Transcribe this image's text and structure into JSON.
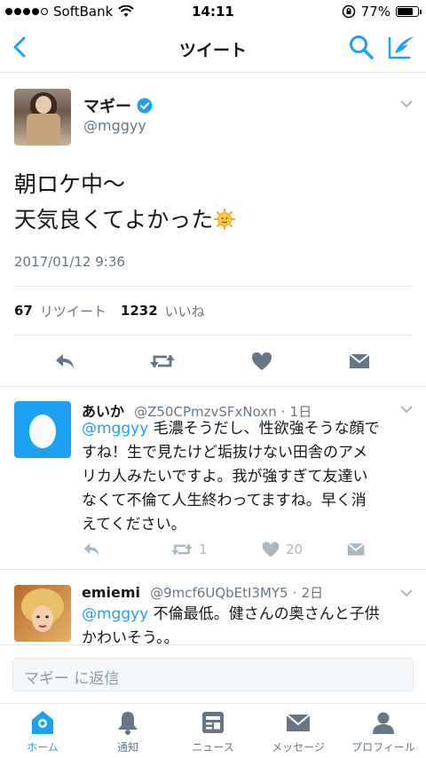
{
  "status_bar": {
    "carrier": "SoftBank",
    "time": "14:11",
    "battery": "77%"
  },
  "nav": {
    "title": "ツイート"
  },
  "tweet": {
    "name": "マギー",
    "handle": "@mggyy",
    "line1": "朝ロケ中〜",
    "line2": "天気良くてよかった",
    "date": "2017/01/12 9:36",
    "retweet_count": "67",
    "retweet_label": "リツイート",
    "like_count": "1232",
    "like_label": "いいね"
  },
  "replies": [
    {
      "name": "あいか",
      "handle": "@Z50CPmzvSFxNoxn",
      "age": "1日",
      "mention": "@mggyy",
      "text_line1": " 毛濃そうだし、性欲強そうな顔で",
      "text_line2": "すね！生で見たけど垢抜けない田舎のアメ",
      "text_line3": "リカ人みたいですよ。我が強すぎて友達い",
      "text_line4": "なくて不倫て人生終わってますね。早く消",
      "text_line5": "えてください。",
      "retweets": "1",
      "likes": "20"
    },
    {
      "name": "emiemi",
      "handle": "@9mcf6UQbEtI3MY5",
      "age": "2日",
      "mention": "@mggyy",
      "text_line1": " 不倫最低。健さんの奥さんと子供",
      "text_line2": "かわいそう。。"
    }
  ],
  "composer": {
    "placeholder": "マギー に返信"
  },
  "tabs": [
    {
      "label": "ホーム"
    },
    {
      "label": "通知"
    },
    {
      "label": "ニュース"
    },
    {
      "label": "メッセージ"
    },
    {
      "label": "プロフィール"
    }
  ],
  "colors": {
    "accent": "#1da1f2",
    "muted": "#657786",
    "icon_gray": "#657786"
  }
}
